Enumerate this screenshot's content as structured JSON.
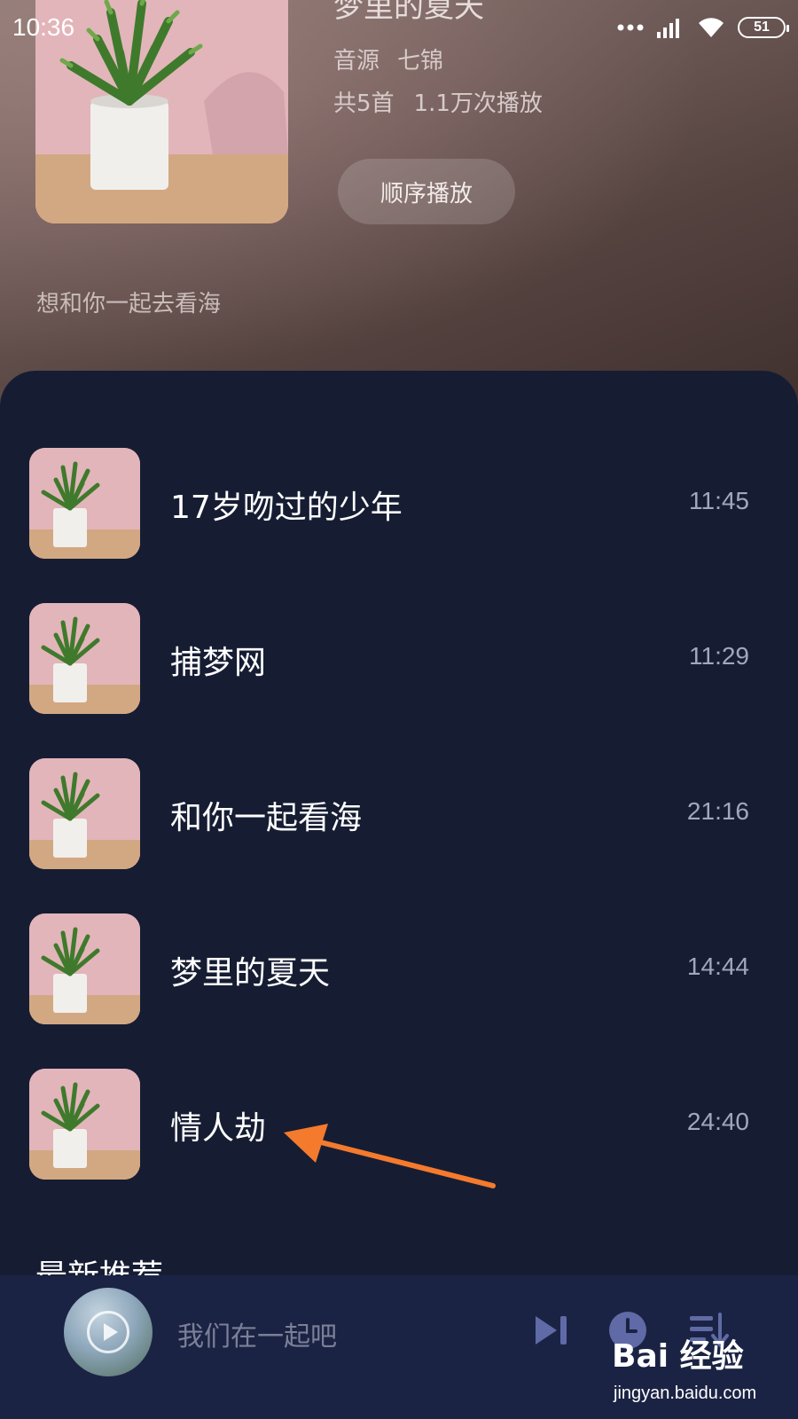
{
  "status_bar": {
    "time": "10:36",
    "battery": "51"
  },
  "album": {
    "title": "梦里的夏天",
    "source_label": "音源",
    "artist": "七锦",
    "track_count": "共5首",
    "play_count": "1.1万次播放",
    "play_order_label": "顺序播放",
    "description": "想和你一起去看海"
  },
  "songs": [
    {
      "title": "17岁吻过的少年",
      "duration": "11:45"
    },
    {
      "title": "捕梦网",
      "duration": "11:29"
    },
    {
      "title": "和你一起看海",
      "duration": "21:16"
    },
    {
      "title": "梦里的夏天",
      "duration": "14:44"
    },
    {
      "title": "情人劫",
      "duration": "24:40"
    }
  ],
  "section_heading": "最新推荐",
  "mini_player": {
    "title": "我们在一起吧"
  },
  "watermark": {
    "logo": "Bai 经验",
    "url": "jingyan.baidu.com"
  },
  "colors": {
    "panel_bg": "#161d33",
    "player_bg": "#1b2344",
    "accent_control": "#5f6aa6",
    "annotation_arrow": "#f47a2d"
  }
}
